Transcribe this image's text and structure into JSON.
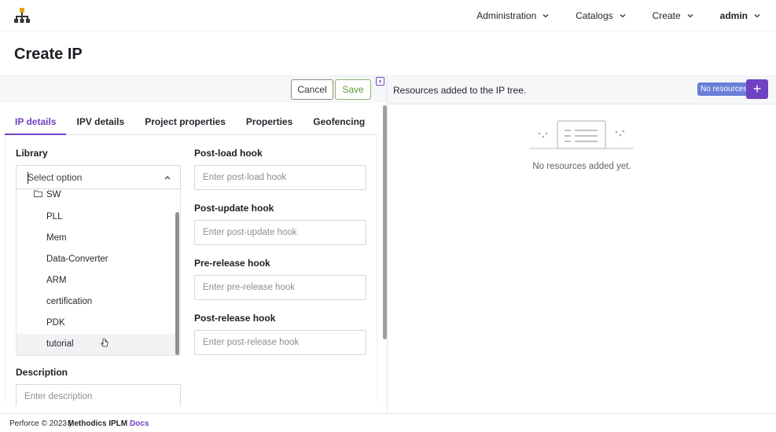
{
  "topbar": {
    "nav": [
      {
        "label": "Administration"
      },
      {
        "label": "Catalogs"
      },
      {
        "label": "Create"
      },
      {
        "label": "admin"
      }
    ]
  },
  "page": {
    "title": "Create IP"
  },
  "toolbar": {
    "cancel_label": "Cancel",
    "save_label": "Save"
  },
  "tabs": [
    "IP details",
    "IPV details",
    "Project properties",
    "Properties",
    "Geofencing"
  ],
  "form": {
    "library_label": "Library",
    "library_select": "Select option",
    "library_options": {
      "folder": "SW",
      "items": [
        "PLL",
        "Mem",
        "Data-Converter",
        "ARM",
        "certification",
        "PDK",
        "tutorial"
      ]
    },
    "description_label": "Description",
    "description_placeholder": "Enter description",
    "post_load_label": "Post-load hook",
    "post_load_placeholder": "Enter post-load hook",
    "post_update_label": "Post-update hook",
    "post_update_placeholder": "Enter post-update hook",
    "pre_release_label": "Pre-release hook",
    "pre_release_placeholder": "Enter pre-release hook",
    "post_release_label": "Post-release hook",
    "post_release_placeholder": "Enter post-release hook"
  },
  "resources": {
    "title": "Resources added to the IP tree.",
    "badge": "No resources",
    "add_label": "+",
    "empty_text": "No resources added yet."
  },
  "footer": {
    "copyright": "Perforce © 2023 |",
    "brand": "Methodics IPLM",
    "docs": "Docs"
  },
  "colors": {
    "accent": "#6f42c1",
    "badge": "#6a7fd8",
    "save": "#5b9a2e"
  }
}
